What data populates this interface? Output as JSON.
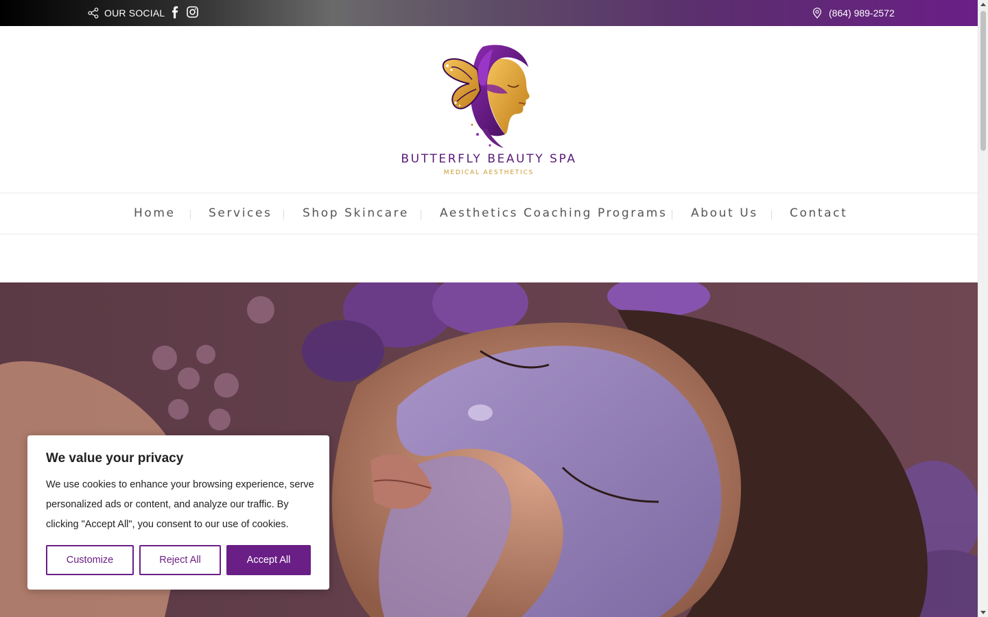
{
  "topbar": {
    "social_label": "OUR SOCIAL",
    "phone": "(864) 989-2572",
    "icons": [
      "share-icon",
      "facebook-icon",
      "instagram-icon",
      "location-pin-icon"
    ]
  },
  "brand": {
    "name": "BUTTERFLY BEAUTY SPA",
    "tagline": "MEDICAL AESTHETICS",
    "colors": {
      "primary": "#5a1a78",
      "accent": "#c9962a"
    }
  },
  "nav": {
    "items": [
      {
        "label": "Home"
      },
      {
        "label": "Services"
      },
      {
        "label": "Shop Skincare"
      },
      {
        "label": "Aesthetics Coaching Programs"
      },
      {
        "label": "About Us"
      },
      {
        "label": "Contact"
      }
    ]
  },
  "cookie": {
    "title": "We value your privacy",
    "body": "We use cookies to enhance your browsing experience, serve personalized ads or content, and analyze our traffic. By clicking \"Accept All\", you consent to our use of cookies.",
    "buttons": {
      "customize": "Customize",
      "reject": "Reject All",
      "accept": "Accept All"
    },
    "accent_color": "#6a1f86"
  }
}
